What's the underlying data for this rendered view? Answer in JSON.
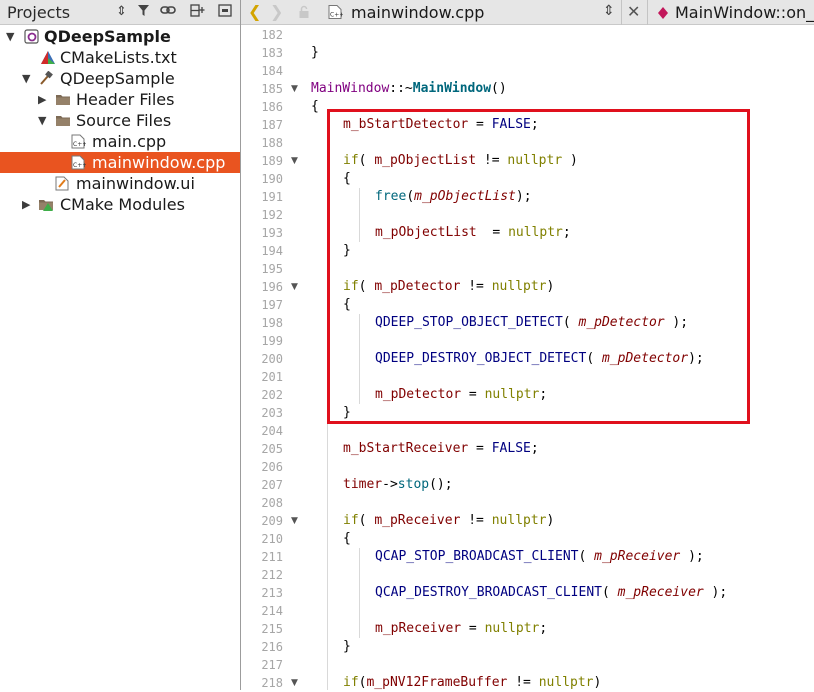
{
  "sidebar": {
    "title": "Projects",
    "tree": [
      {
        "label": "QDeepSample",
        "icon": "qt-project-icon"
      },
      {
        "label": "CMakeLists.txt",
        "icon": "cmake-file-icon"
      },
      {
        "label": "QDeepSample",
        "icon": "hammer-icon"
      },
      {
        "label": "Header Files",
        "icon": "folder-icon"
      },
      {
        "label": "Source Files",
        "icon": "folder-icon"
      },
      {
        "label": "main.cpp",
        "icon": "cpp-file-icon"
      },
      {
        "label": "mainwindow.cpp",
        "icon": "cpp-file-icon"
      },
      {
        "label": "mainwindow.ui",
        "icon": "ui-file-icon"
      },
      {
        "label": "CMake Modules",
        "icon": "cmake-modules-icon"
      }
    ]
  },
  "editor": {
    "file_name": "mainwindow.cpp",
    "symbol": "MainWindow::on_",
    "line_numbers": [
      "182",
      "183",
      "184",
      "185",
      "186",
      "187",
      "188",
      "189",
      "190",
      "191",
      "192",
      "193",
      "194",
      "195",
      "196",
      "197",
      "198",
      "199",
      "200",
      "201",
      "202",
      "203",
      "204",
      "205",
      "206",
      "207",
      "208",
      "209",
      "210",
      "211",
      "212",
      "213",
      "214",
      "215",
      "216",
      "217",
      "218"
    ],
    "code": {
      "l183": "}",
      "l185_a": "MainWindow",
      "l185_b": "::~",
      "l185_c": "MainWindow",
      "l185_d": "()",
      "l186": "{",
      "l187_a": "m_bStartDetector",
      "l187_b": " = ",
      "l187_c": "FALSE",
      "l187_d": ";",
      "l189_a": "if",
      "l189_b": "( ",
      "l189_c": "m_pObjectList",
      "l189_d": " != ",
      "l189_e": "nullptr",
      "l189_f": " )",
      "l190": "{",
      "l191_a": "free",
      "l191_b": "(",
      "l191_c": "m_pObjectList",
      "l191_d": ");",
      "l193_a": "m_pObjectList",
      "l193_b": "  = ",
      "l193_c": "nullptr",
      "l193_d": ";",
      "l194": "}",
      "l196_a": "if",
      "l196_b": "( ",
      "l196_c": "m_pDetector",
      "l196_d": " != ",
      "l196_e": "nullptr",
      "l196_f": ")",
      "l197": "{",
      "l198_a": "QDEEP_STOP_OBJECT_DETECT",
      "l198_b": "( ",
      "l198_c": "m_pDetector",
      "l198_d": " );",
      "l200_a": "QDEEP_DESTROY_OBJECT_DETECT",
      "l200_b": "( ",
      "l200_c": "m_pDetector",
      "l200_d": ");",
      "l202_a": "m_pDetector",
      "l202_b": " = ",
      "l202_c": "nullptr",
      "l202_d": ";",
      "l203": "}",
      "l205_a": "m_bStartReceiver",
      "l205_b": " = ",
      "l205_c": "FALSE",
      "l205_d": ";",
      "l207_a": "timer",
      "l207_b": "->",
      "l207_c": "stop",
      "l207_d": "();",
      "l209_a": "if",
      "l209_b": "( ",
      "l209_c": "m_pReceiver",
      "l209_d": " != ",
      "l209_e": "nullptr",
      "l209_f": ")",
      "l210": "{",
      "l211_a": "QCAP_STOP_BROADCAST_CLIENT",
      "l211_b": "( ",
      "l211_c": "m_pReceiver",
      "l211_d": " );",
      "l213_a": "QCAP_DESTROY_BROADCAST_CLIENT",
      "l213_b": "( ",
      "l213_c": "m_pReceiver",
      "l213_d": " );",
      "l215_a": "m_pReceiver",
      "l215_b": " = ",
      "l215_c": "nullptr",
      "l215_d": ";",
      "l216": "}",
      "l218_a": "if",
      "l218_b": "(",
      "l218_c": "m_pNV12FrameBuffer",
      "l218_d": " != ",
      "l218_e": "nullptr",
      "l218_f": ")"
    }
  },
  "colors": {
    "selection": "#e95420",
    "highlight_box": "#e0101d",
    "keyword": "#808000",
    "member": "#800000"
  }
}
